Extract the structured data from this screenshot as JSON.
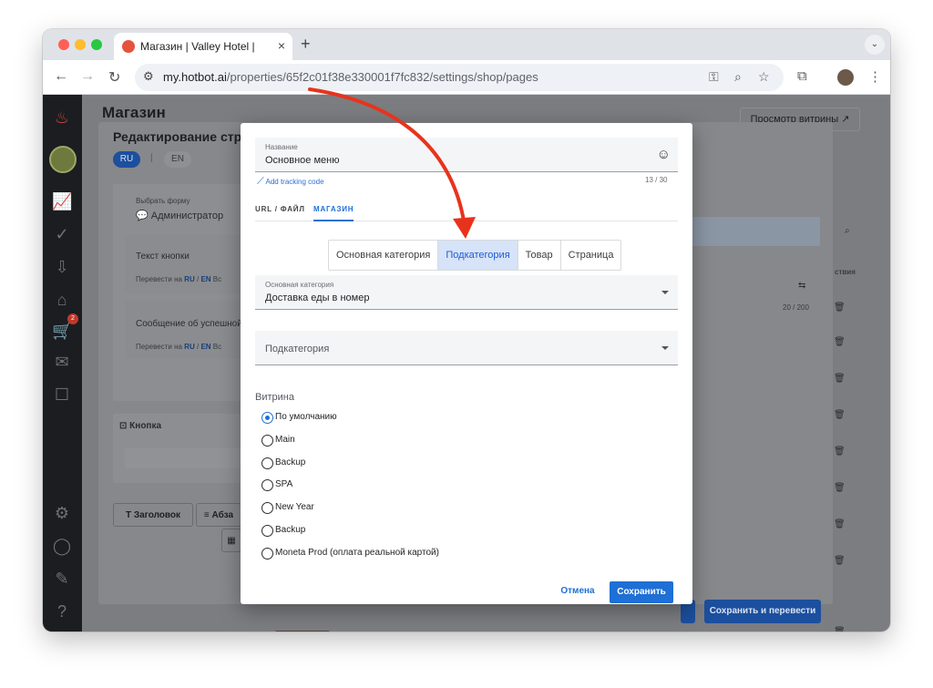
{
  "browser": {
    "tab_title": "Магазин | Valley Hotel | Hotbot",
    "url_host": "my.hotbot.ai",
    "url_path": "/properties/65f2c01f38e330001f7fc832/settings/shop/pages"
  },
  "background": {
    "page_title": "Магазин",
    "preview_button": "Просмотр витрины",
    "panel_title": "Редактирование стра",
    "lang_ru": "RU",
    "lang_sep": "|",
    "lang_en": "EN",
    "choose_form_label": "Выбрать форму",
    "choose_form_value": "Администратор",
    "button_text_label": "Текст кнопки",
    "translate_to": "Перевести на",
    "translate_ru": "RU",
    "translate_sep": "/",
    "translate_en": "EN",
    "translate_more": "Вс",
    "success_message_label": "Сообщение об успешной",
    "button_section": "Кнопка",
    "heading_tool": "Заголовок",
    "paragraph_tool": "Абза",
    "counter_right": "20 / 200",
    "actions_header": "ствия",
    "cart_badge": "2",
    "save_translate_button": "Сохранить и перевести"
  },
  "modal": {
    "name_label": "Название",
    "name_value": "Основное меню",
    "tracking_link": "Add tracking code",
    "name_counter": "13 / 30",
    "tabs": [
      {
        "label": "URL / ФАЙЛ"
      },
      {
        "label": "МАГАЗИН"
      }
    ],
    "segments": [
      {
        "label": "Основная категория"
      },
      {
        "label": "Подкатегория"
      },
      {
        "label": "Товар"
      },
      {
        "label": "Страница"
      }
    ],
    "main_category_label": "Основная категория",
    "main_category_value": "Доставка еды в номер",
    "subcategory_placeholder": "Подкатегория",
    "showcase_label": "Витрина",
    "showcase_options": [
      {
        "label": "По умолчанию",
        "selected": true
      },
      {
        "label": "Main",
        "selected": false
      },
      {
        "label": "Backup",
        "selected": false
      },
      {
        "label": "SPA",
        "selected": false
      },
      {
        "label": "New Year",
        "selected": false
      },
      {
        "label": "Backup",
        "selected": false
      },
      {
        "label": "Moneta Prod (оплата реальной картой)",
        "selected": false
      }
    ],
    "cancel_button": "Отмена",
    "save_button": "Сохранить"
  },
  "colors": {
    "accent": "#1e6fd6",
    "annotation_arrow": "#e8331c",
    "sidebar": "#1b1d21"
  }
}
